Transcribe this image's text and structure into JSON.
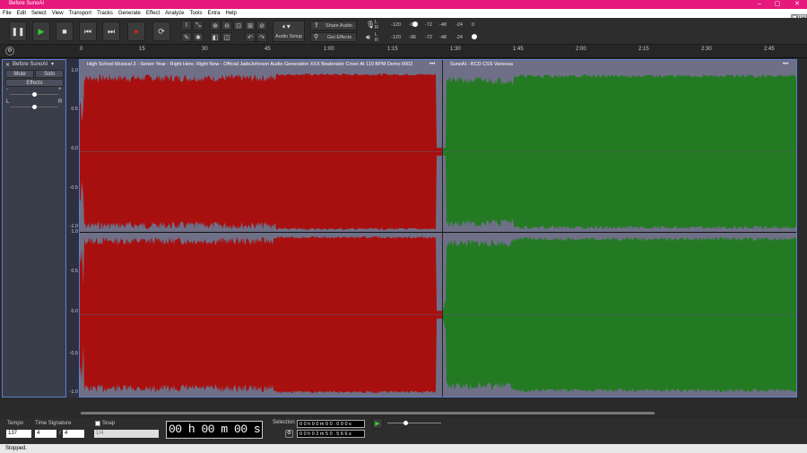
{
  "window": {
    "title": "Before SunoAI",
    "minimize": "–",
    "maximize": "▢",
    "close": "✕",
    "close_tooltip": "Close"
  },
  "menu": [
    "File",
    "Edit",
    "Select",
    "View",
    "Transport",
    "Tracks",
    "Generate",
    "Effect",
    "Analyze",
    "Tools",
    "Extra",
    "Help"
  ],
  "toolbar": {
    "audio_setup": "Audio Setup",
    "share_audio": "Share Audio",
    "get_effects": "Get Effects",
    "meter_ticks_record": [
      "-120",
      "-96",
      "-72",
      "-48",
      "-24",
      "0"
    ],
    "meter_ticks_play": [
      "-120",
      "-96",
      "-72",
      "-48",
      "-24",
      "0"
    ],
    "rec_label_l": "L",
    "rec_label_r": "R",
    "play_label_l": "L",
    "play_label_r": "R"
  },
  "ruler": {
    "ticks": [
      "0",
      "15",
      "30",
      "45",
      "1:00",
      "1:15",
      "1:30",
      "1:45",
      "2:00",
      "2:15",
      "2:30",
      "2:45"
    ]
  },
  "track": {
    "name": "Before SunoAI",
    "mute": "Mute",
    "solo": "Solo",
    "effects": "Effects",
    "gain_minus": "-",
    "gain_plus": "+",
    "pan_l": "L",
    "pan_r": "R",
    "close_x": "✕",
    "menu_caret": "▾"
  },
  "scale_labels": [
    "1.0",
    "0.5",
    "0.0",
    "-0.5",
    "-1.0",
    "1.0",
    "0.5",
    "0.0",
    "-0.5",
    "-1.0"
  ],
  "clips": [
    {
      "title": "High School Musical 3 - Senior Year - Right Here, Right Now - Official JadeJohnson Audio Generation XXX Beaterator Cover At 110 BPM Demo 0002",
      "color": "#a81010",
      "more": "•••"
    },
    {
      "title": "SunoAI - BCD CSS Vanessa",
      "color": "#237a23",
      "more": "•••"
    }
  ],
  "bottom": {
    "tempo_label": "Tempo",
    "tempo_value": "137",
    "timesig_label": "Time Signature",
    "timesig_num": "4",
    "timesig_den": "4",
    "timesig_slash": "/",
    "snap_label": "Snap",
    "snap_value": "1/4",
    "big_time": "00 h 00 m 00 s",
    "selection_label": "Selection",
    "sel_start": "0 0 h 0 0 m 0 0 . 0 0 0 s",
    "sel_end": "0 0 h 0 2 m 5 0 . 5 6 6 s"
  },
  "status": "Stopped."
}
